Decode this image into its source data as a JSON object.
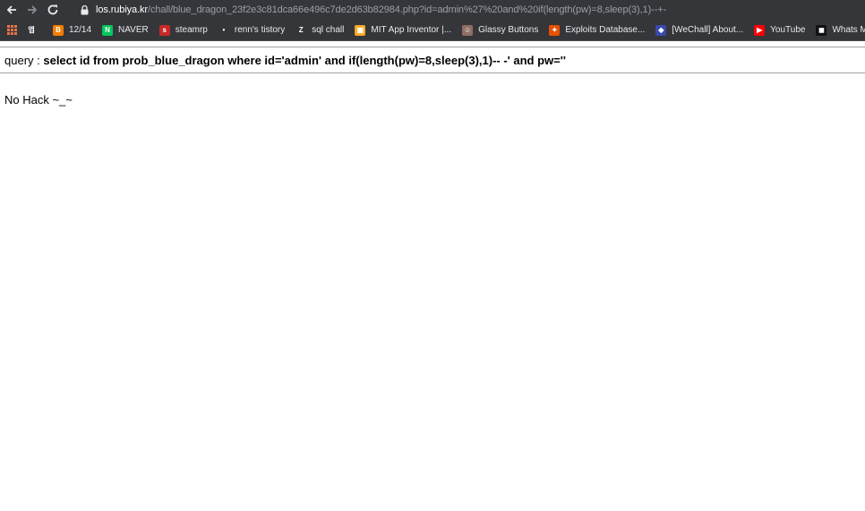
{
  "browser": {
    "url_host": "los.rubiya.kr",
    "url_path": "/chall/blue_dragon_23f2e3c81dca66e496c7de2d63b82984.php?id=admin%27%20and%20if(length(pw)=8,sleep(3),1)--+-"
  },
  "bookmarks": [
    {
      "label": "",
      "icon": "korean-text-icon",
      "glyph": "앱",
      "color": "#35363a"
    },
    {
      "label": "12/14",
      "icon": "blogger-icon",
      "glyph": "B",
      "color": "#f57d00"
    },
    {
      "label": "NAVER",
      "icon": "naver-icon",
      "glyph": "N",
      "color": "#03c75a"
    },
    {
      "label": "steamrp",
      "icon": "steam-icon",
      "glyph": "s",
      "color": "#c62828"
    },
    {
      "label": "renn's tistory",
      "icon": "tistory-icon",
      "glyph": "•",
      "color": "#35363a"
    },
    {
      "label": "sql chall",
      "icon": "z-icon",
      "glyph": "Z",
      "color": "#35363a"
    },
    {
      "label": "MIT App Inventor |...",
      "icon": "app-inventor-icon",
      "glyph": "▣",
      "color": "#f9a825"
    },
    {
      "label": "Glassy Buttons",
      "icon": "glassy-icon",
      "glyph": "☺",
      "color": "#8d6e63"
    },
    {
      "label": "Exploits Database...",
      "icon": "exploit-db-icon",
      "glyph": "✦",
      "color": "#e65100"
    },
    {
      "label": "[WeChall] About...",
      "icon": "wechall-icon",
      "glyph": "◆",
      "color": "#3949ab"
    },
    {
      "label": "YouTube",
      "icon": "youtube-icon",
      "glyph": "▶",
      "color": "#ff0000"
    },
    {
      "label": "Whats My IP Addr...",
      "icon": "ip-icon",
      "glyph": "◼",
      "color": "#111111"
    }
  ],
  "page": {
    "query_prefix": "query : ",
    "query_text": "select id from prob_blue_dragon where id='admin' and if(length(pw)=8,sleep(3),1)-- -' and pw=''",
    "result_text": "No Hack ~_~"
  }
}
